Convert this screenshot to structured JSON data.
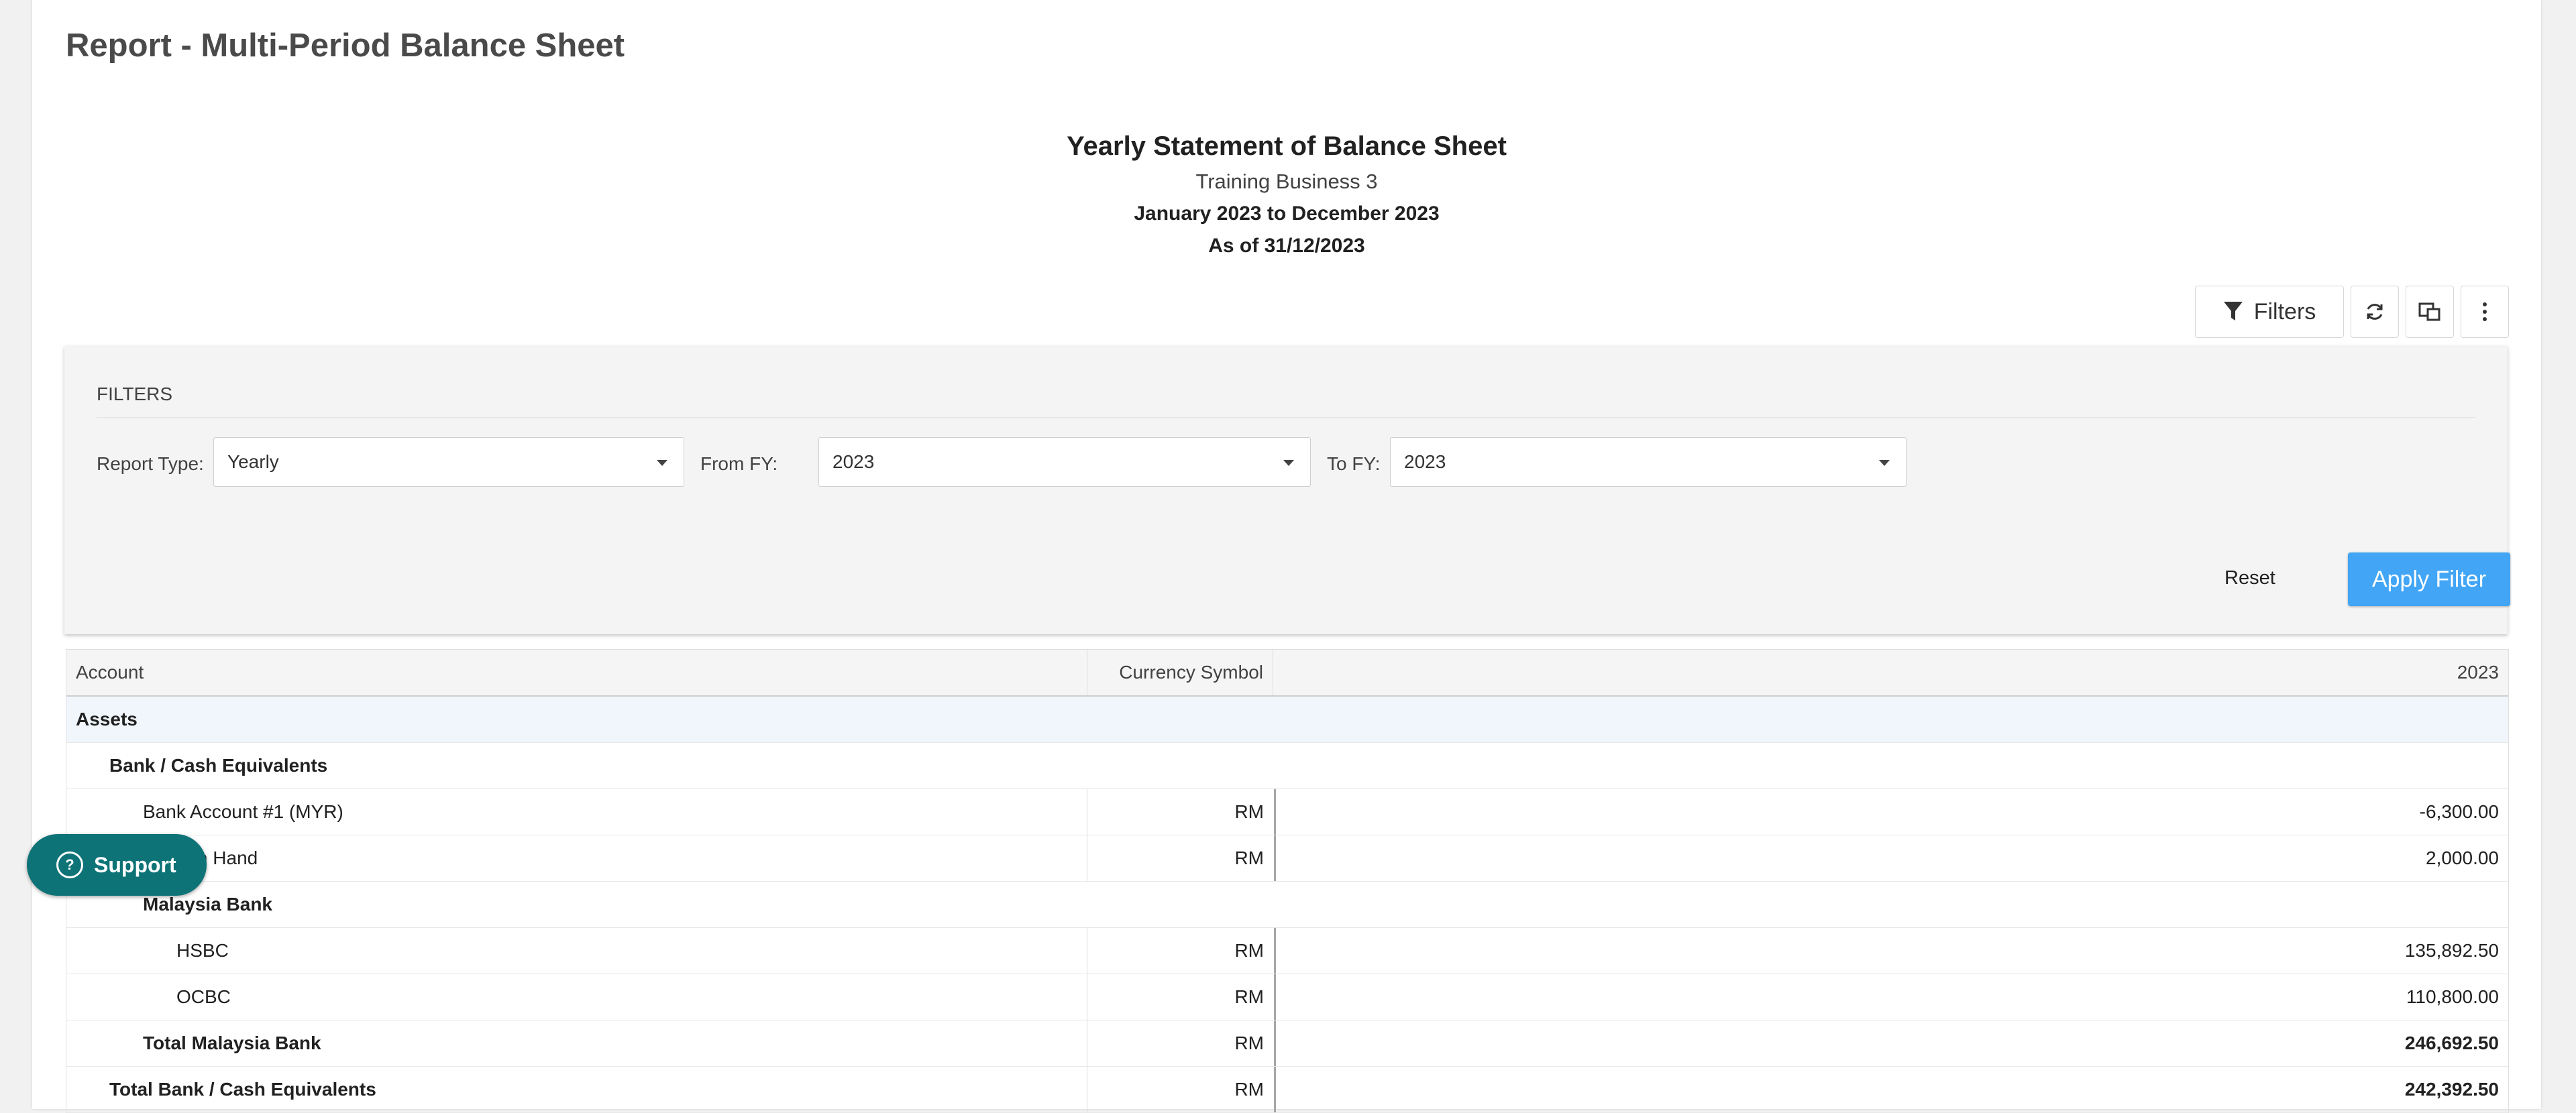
{
  "page": {
    "title": "Report - Multi-Period Balance Sheet"
  },
  "report_header": {
    "title": "Yearly Statement of Balance Sheet",
    "business": "Training Business 3",
    "period": "January 2023 to December 2023",
    "as_of": "As of 31/12/2023"
  },
  "toolbar": {
    "filters_label": "Filters",
    "icons": [
      "filter-icon",
      "refresh-icon",
      "copy-icon",
      "more-vertical-icon"
    ]
  },
  "filters": {
    "heading": "FILTERS",
    "report_type_label": "Report Type:",
    "report_type_value": "Yearly",
    "from_fy_label": "From FY:",
    "from_fy_value": "2023",
    "to_fy_label": "To FY:",
    "to_fy_value": "2023",
    "reset_label": "Reset",
    "apply_label": "Apply Filter"
  },
  "table": {
    "columns": [
      "Account",
      "Currency Symbol",
      "2023"
    ],
    "rows": [
      {
        "account": "Assets",
        "currency": "",
        "value": "",
        "level": 0,
        "bold": true,
        "section": true
      },
      {
        "account": "Bank / Cash Equivalents",
        "currency": "",
        "value": "",
        "level": 1,
        "bold": true
      },
      {
        "account": "Bank Account #1 (MYR)",
        "currency": "RM",
        "value": "-6,300.00",
        "level": 2,
        "bold": false
      },
      {
        "account": "Cash In Hand",
        "currency": "RM",
        "value": "2,000.00",
        "level": 2,
        "bold": false
      },
      {
        "account": "Malaysia Bank",
        "currency": "",
        "value": "",
        "level": 2,
        "bold": true
      },
      {
        "account": "HSBC",
        "currency": "RM",
        "value": "135,892.50",
        "level": 3,
        "bold": false
      },
      {
        "account": "OCBC",
        "currency": "RM",
        "value": "110,800.00",
        "level": 3,
        "bold": false
      },
      {
        "account": "Total Malaysia Bank",
        "currency": "RM",
        "value": "246,692.50",
        "level": 2,
        "bold": true
      },
      {
        "account": "Total Bank / Cash Equivalents",
        "currency": "RM",
        "value": "242,392.50",
        "level": 1,
        "bold": true
      }
    ]
  },
  "support": {
    "label": "Support"
  },
  "colors": {
    "apply_button": "#42a5f5",
    "support_button": "#0d7377",
    "section_row": "#f0f6fb"
  }
}
